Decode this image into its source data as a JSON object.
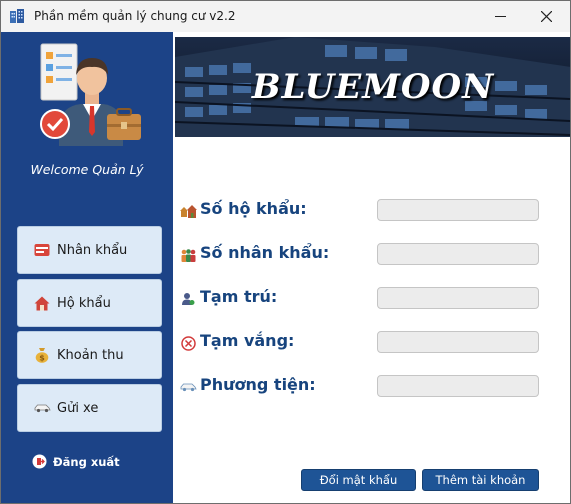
{
  "window": {
    "title": "Phần mềm quản lý chung cư v2.2",
    "minimize_glyph": "—",
    "close_glyph": "✕"
  },
  "sidebar": {
    "welcome": "Welcome Quản Lý",
    "items": [
      {
        "label": "Nhân khẩu",
        "icon": "id-card-icon"
      },
      {
        "label": "Hộ khẩu",
        "icon": "house-icon"
      },
      {
        "label": "Khoản thu",
        "icon": "money-bag-icon"
      },
      {
        "label": "Gửi xe",
        "icon": "car-icon"
      }
    ],
    "logout": {
      "label": "Đăng xuất",
      "icon": "logout-icon"
    }
  },
  "banner": {
    "title": "BLUEMOON"
  },
  "form": {
    "fields": [
      {
        "label": "Số hộ khẩu:",
        "value": "",
        "icon": "houses-icon"
      },
      {
        "label": "Số nhân khẩu:",
        "value": "",
        "icon": "people-icon"
      },
      {
        "label": "Tạm trú:",
        "value": "",
        "icon": "person-icon"
      },
      {
        "label": "Tạm vắng:",
        "value": "",
        "icon": "cancel-circle-icon"
      },
      {
        "label": "Phương tiện:",
        "value": "",
        "icon": "car-icon"
      }
    ]
  },
  "actions": {
    "change_password": "Đổi mật khẩu",
    "add_account": "Thêm tài khoản"
  },
  "colors": {
    "sidebar_bg": "#1c4387",
    "nav_button_bg": "#ddeaf7",
    "label_color": "#17447e",
    "action_button_bg": "#1e5496"
  }
}
